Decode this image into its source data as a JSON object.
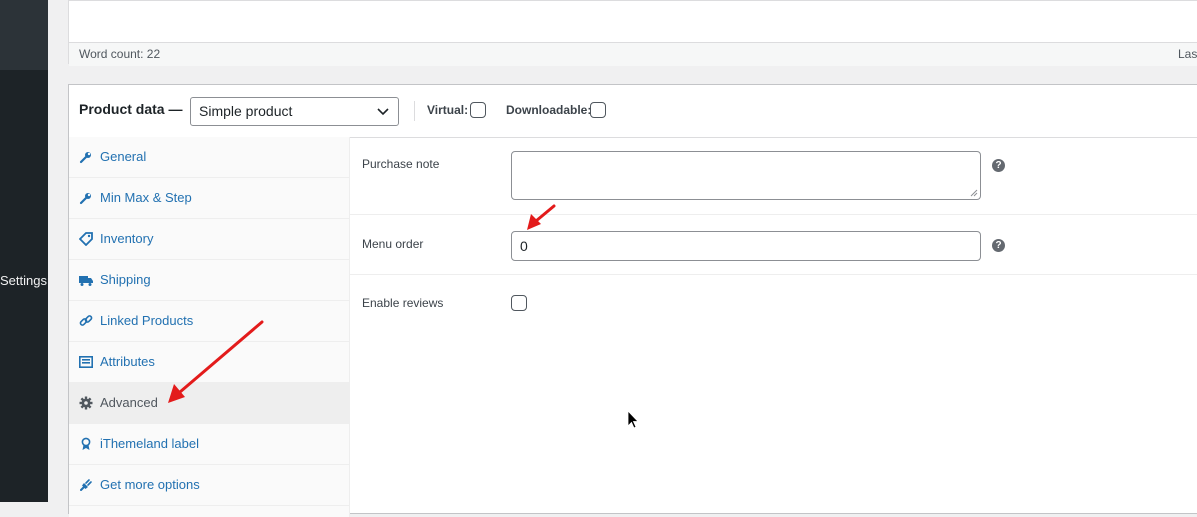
{
  "admin_menu": {
    "settings_label": "Settings"
  },
  "editor": {
    "word_count": "Word count: 22",
    "last_edited": "Last edited"
  },
  "product_data": {
    "title": "Product data —",
    "product_type": "Simple product",
    "virtual_label": "Virtual:",
    "downloadable_label": "Downloadable:",
    "tabs": [
      {
        "label": "General",
        "icon": "wrench-icon"
      },
      {
        "label": "Min Max & Step",
        "icon": "wrench-icon"
      },
      {
        "label": "Inventory",
        "icon": "tag-icon"
      },
      {
        "label": "Shipping",
        "icon": "truck-icon"
      },
      {
        "label": "Linked Products",
        "icon": "link-icon"
      },
      {
        "label": "Attributes",
        "icon": "list-icon"
      },
      {
        "label": "Advanced",
        "icon": "gear-icon",
        "active": true
      },
      {
        "label": "iThemeland label",
        "icon": "award-icon"
      },
      {
        "label": "Get more options",
        "icon": "plugin-icon"
      }
    ],
    "fields": {
      "purchase_note": {
        "label": "Purchase note",
        "value": ""
      },
      "menu_order": {
        "label": "Menu order",
        "value": "0"
      },
      "enable_reviews": {
        "label": "Enable reviews",
        "checked": false
      }
    },
    "help_glyph": "?"
  },
  "colors": {
    "link": "#2271b1",
    "sidebar": "#1d2327",
    "annotation_arrow": "#e31b1b"
  }
}
